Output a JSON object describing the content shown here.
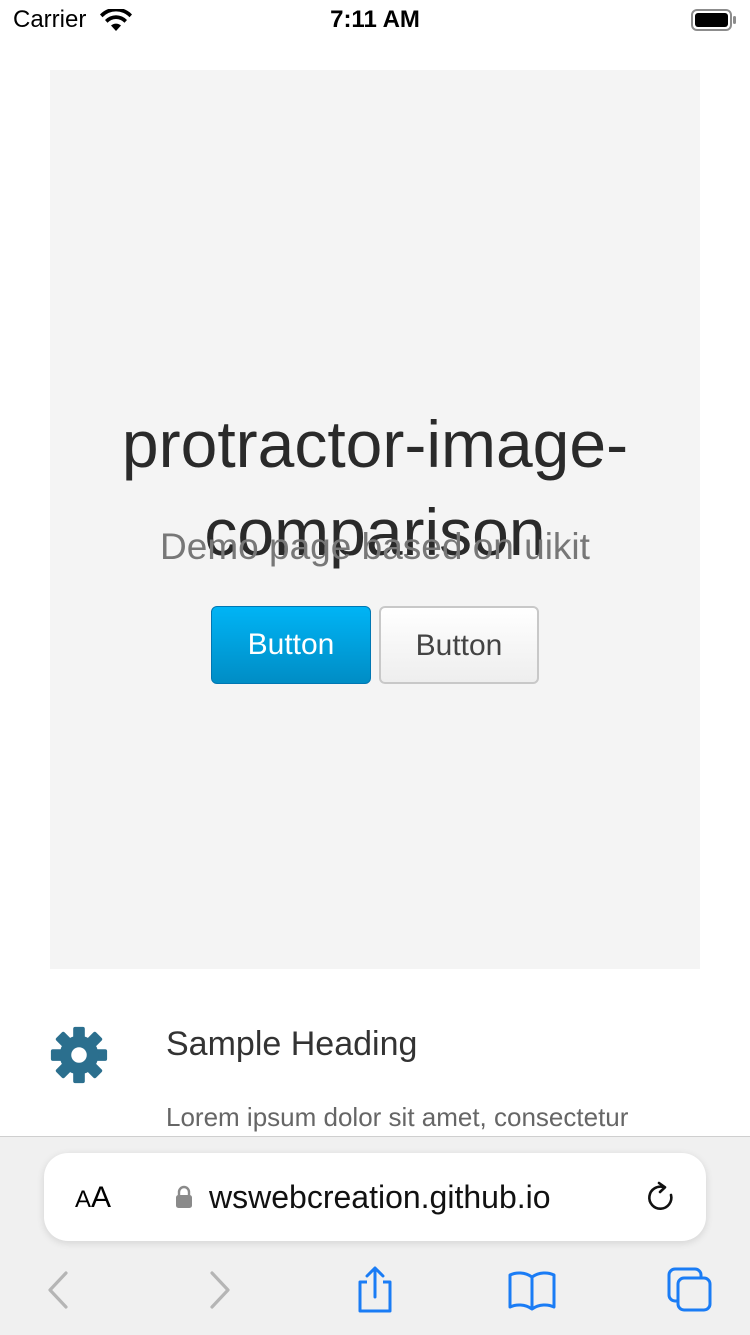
{
  "status_bar": {
    "carrier": "Carrier",
    "time": "7:11 AM"
  },
  "hero": {
    "title_line1": "protractor-image-",
    "title_line2": "comparison",
    "subtitle": "Demo page based on uikit",
    "primary_button": "Button",
    "default_button": "Button"
  },
  "section": {
    "icon": "gear-icon",
    "heading": "Sample Heading",
    "body": "Lorem ipsum dolor sit amet, consectetur"
  },
  "safari": {
    "text_size_small": "A",
    "text_size_big": "A",
    "url": "wswebcreation.github.io",
    "icons": [
      "lock-icon",
      "reload-icon",
      "back-icon",
      "forward-icon",
      "share-icon",
      "bookmarks-icon",
      "tabs-icon"
    ]
  },
  "colors": {
    "primary_button": "#00a8e6",
    "icon_teal": "#2b6f8e",
    "safari_blue": "#1a7cf5",
    "hero_bg": "#f4f4f4"
  }
}
